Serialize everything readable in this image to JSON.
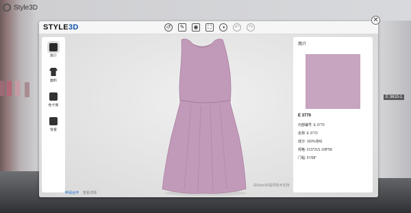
{
  "app": {
    "name": "Style3D"
  },
  "background": {
    "tag": "E 3610-1"
  },
  "modal": {
    "brand_prefix": "STYLE",
    "brand_suffix": "3D",
    "toolbar": [
      {
        "icon": "reset-icon",
        "glyph": "↺"
      },
      {
        "icon": "tool-icon",
        "glyph": "✎"
      },
      {
        "icon": "camera-icon",
        "glyph": "◉"
      },
      {
        "icon": "fullscreen-icon",
        "glyph": "⛶"
      },
      {
        "icon": "light-icon",
        "glyph": "◑"
      },
      {
        "icon": "undo-icon",
        "glyph": "↶"
      },
      {
        "icon": "redo-icon",
        "glyph": "↷"
      }
    ],
    "nav": [
      {
        "label": "简介",
        "icon": "info-icon"
      },
      {
        "label": "面料",
        "icon": "shirt-icon"
      },
      {
        "label": "色卡库",
        "icon": "palette-icon"
      },
      {
        "label": "背景",
        "icon": "image-icon"
      }
    ],
    "links": {
      "apply": "申请合作",
      "view_detail": "查看详情"
    },
    "credit": "由Style3D提供技术支持",
    "panel": {
      "title": "简介",
      "fabric_name": "E 3770",
      "rows": [
        {
          "label": "内部编号:",
          "value": "E 3770"
        },
        {
          "label": "名称:",
          "value": "E 3770"
        },
        {
          "label": "成分:",
          "value": "100%涤纶"
        },
        {
          "label": "规格:",
          "value": "21S*21S 108*58"
        },
        {
          "label": "门幅:",
          "value": "57/58\""
        }
      ]
    },
    "colors": {
      "fabric": "#c7a4c0",
      "dress": "#c29ab9",
      "accent": "#1b6fd6"
    }
  }
}
